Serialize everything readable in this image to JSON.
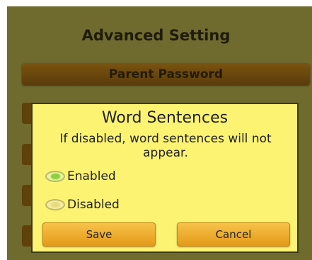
{
  "settings_page": {
    "title": "Advanced Setting",
    "parent_password_label": "Parent Password"
  },
  "dialog": {
    "title": "Word Sentences",
    "message": "If disabled, word sentences will not appear.",
    "options": [
      {
        "label": "Enabled",
        "selected": true
      },
      {
        "label": "Disabled",
        "selected": false
      }
    ],
    "save_label": "Save",
    "cancel_label": "Cancel"
  },
  "colors": {
    "background": "#6f6a2e",
    "dialog_background": "#fdf373",
    "button_orange": "#f0a830",
    "menu_button_brown": "#6a4a0e",
    "radio_selected": "#8fd043"
  }
}
